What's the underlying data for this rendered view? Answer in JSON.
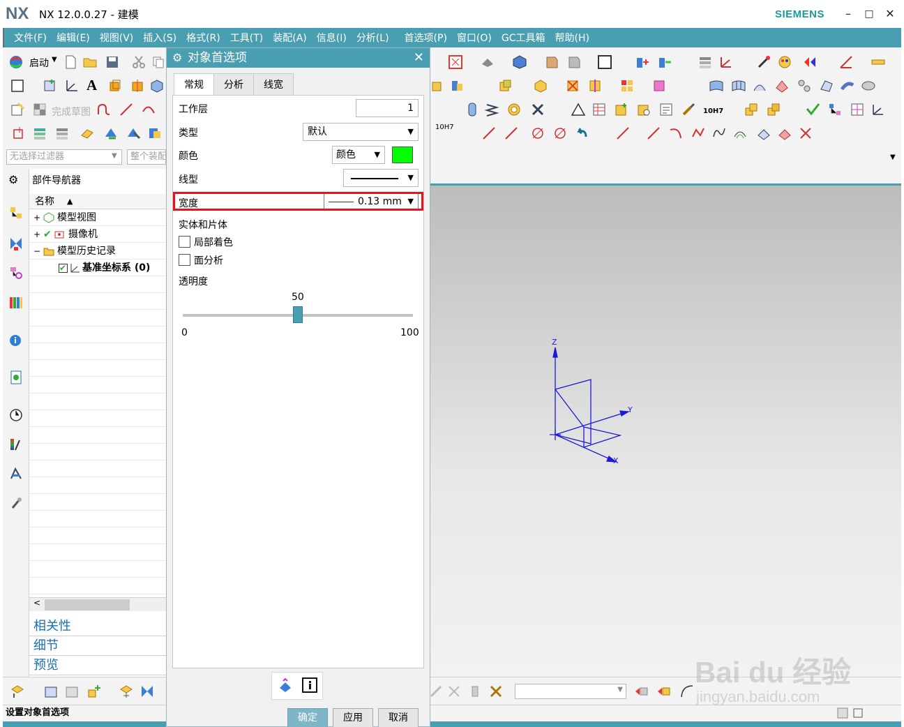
{
  "window": {
    "logo": "NX",
    "title": "NX 12.0.0.27 - 建模",
    "brand": "SIEMENS",
    "minimize": "–",
    "maximize": "□",
    "close": "✕"
  },
  "menu": [
    "文件(F)",
    "编辑(E)",
    "视图(V)",
    "插入(S)",
    "格式(R)",
    "工具(T)",
    "装配(A)",
    "信息(I)",
    "分析(L)",
    "首选项(P)",
    "窗口(O)",
    "GC工具箱",
    "帮助(H)"
  ],
  "toolbar": {
    "start_label": "启动",
    "finish_sketch_label": "完成草图",
    "filter_placeholder": "无选择过滤器",
    "assembly_placeholder": "整个装配",
    "tol_label_1": "10H7",
    "tol_label_2": "10H7"
  },
  "navigator": {
    "title": "部件导航器",
    "column_name": "名称",
    "items": [
      {
        "label": "模型视图"
      },
      {
        "label": "摄像机"
      },
      {
        "label": "模型历史记录"
      },
      {
        "label": "基准坐标系 (0)"
      }
    ],
    "panels": [
      "相关性",
      "细节",
      "预览"
    ]
  },
  "dialog": {
    "title": "对象首选项",
    "tabs": [
      "常规",
      "分析",
      "线宽"
    ],
    "active_tab": 0,
    "work_layer_label": "工作层",
    "work_layer_value": "1",
    "type_label": "类型",
    "type_value": "默认",
    "color_label": "颜色",
    "color_value": "颜色",
    "color_swatch": "#00ff00",
    "linetype_label": "线型",
    "width_label": "宽度",
    "width_value": "0.13 mm",
    "solids_section": "实体和片体",
    "partial_shading_label": "局部着色",
    "partial_shading_checked": false,
    "face_analysis_label": "面分析",
    "face_analysis_checked": false,
    "transparency_label": "透明度",
    "transparency_value": "50",
    "transparency_min": "0",
    "transparency_max": "100",
    "transparency_fraction": 0.5,
    "ok_label": "确定",
    "apply_label": "应用",
    "cancel_label": "取消"
  },
  "axes": {
    "z": "Z",
    "y": "Y",
    "x": "X"
  },
  "status": {
    "text": "设置对象首选项"
  },
  "watermark": {
    "text": "Bai du 经验",
    "sub": "jingyan.baidu.com"
  },
  "colors": {
    "accent": "#4a9eb2",
    "highlight": "#e8131d",
    "csys": "#1a1ad6"
  }
}
